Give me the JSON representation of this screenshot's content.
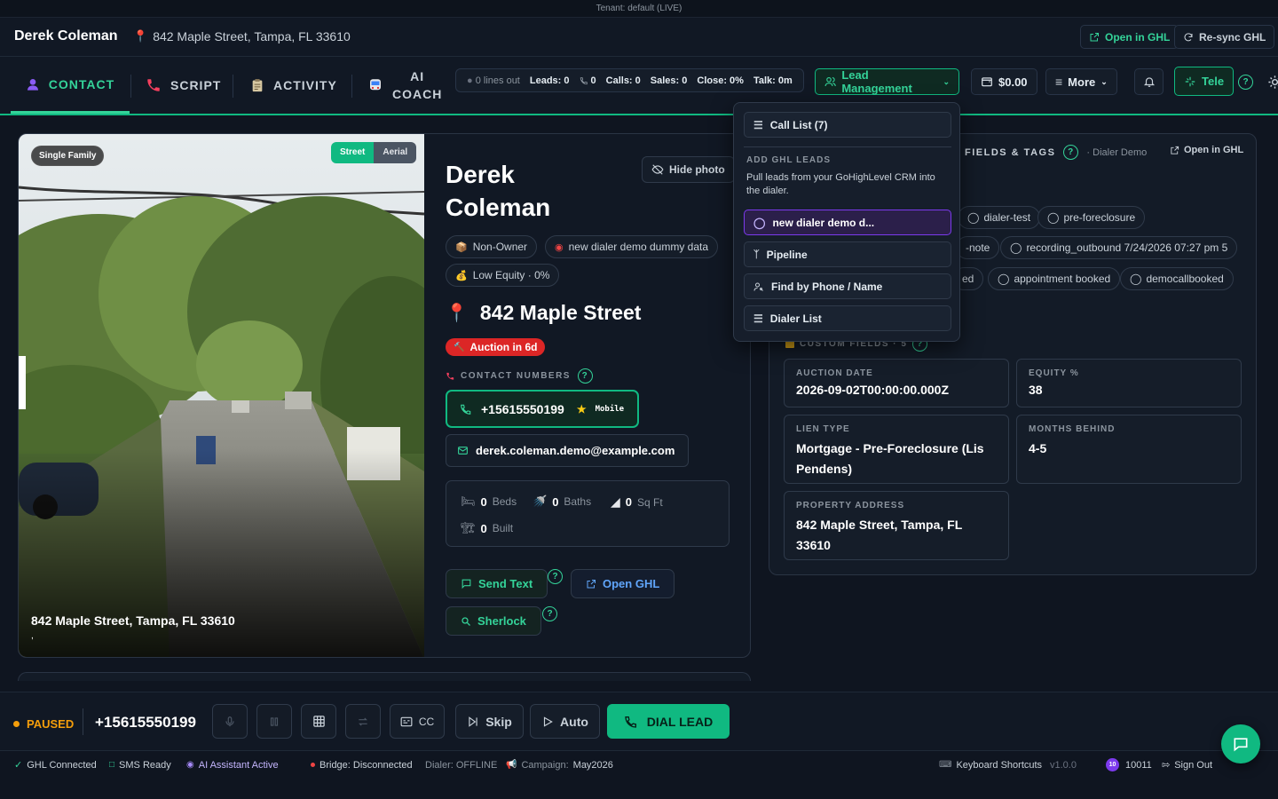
{
  "tenant": "Tenant: default (LIVE)",
  "header": {
    "contact_name": "Derek Coleman",
    "address": "842 Maple Street, Tampa, FL 33610",
    "open_ghl": "Open in GHL",
    "resync_ghl": "Re-sync GHL"
  },
  "tabs": [
    {
      "label": "CONTACT"
    },
    {
      "label": "SCRIPT"
    },
    {
      "label": "ACTIVITY"
    },
    {
      "label_line1": "AI",
      "label_line2": "COACH"
    }
  ],
  "stats": {
    "lines_out": "0 lines out",
    "leads": "Leads: 0",
    "phone_count": "0",
    "calls": "Calls: 0",
    "sales": "Sales: 0",
    "close": "Close: 0%",
    "talk": "Talk: 0m"
  },
  "nav": {
    "lead_management": "Lead Management",
    "balance": "$0.00",
    "more": "More",
    "tele": "Tele"
  },
  "dropdown": {
    "call_list": "Call List (7)",
    "section_title": "ADD GHL LEADS",
    "section_desc": "Pull leads from your GoHighLevel CRM into the dialer.",
    "items": [
      "new dialer demo d...",
      "Pipeline",
      "Find by Phone / Name",
      "Dialer List"
    ]
  },
  "photo": {
    "tag": "Single Family",
    "street_btn": "Street",
    "aerial_btn": "Aerial",
    "caption": "842 Maple Street, Tampa, FL 33610",
    "caption_sub": ","
  },
  "contact": {
    "first_name": "Derek",
    "last_name": "Coleman",
    "hide_photo": "Hide photo",
    "chips": [
      "Non-Owner",
      "new dialer demo dummy data",
      "Low Equity · 0%"
    ],
    "street": "842 Maple Street",
    "auction": "Auction in 6d",
    "numbers_label": "CONTACT NUMBERS",
    "phone": "+15615550199",
    "phone_type": "Mobile",
    "email": "derek.coleman.demo@example.com",
    "beds_val": "0",
    "beds_lbl": "Beds",
    "baths_val": "0",
    "baths_lbl": "Baths",
    "sqft_val": "0",
    "sqft_lbl": "Sq Ft",
    "built_val": "0",
    "built_lbl": "Built",
    "send_text": "Send Text",
    "open_ghl": "Open GHL",
    "sherlock": "Sherlock"
  },
  "right_panel": {
    "title": "FIELDS & TAGS",
    "subtitle": "· Dialer Demo",
    "open_ghl": "Open in GHL",
    "tags": [
      "dialer-test",
      "pre-foreclosure",
      "-note",
      "recording_outbound 7/24/2026 07:27 pm 5",
      "ed",
      "appointment booked",
      "democallbooked"
    ],
    "custom_fields_label": "CUSTOM FIELDS · 5",
    "fields": [
      {
        "label": "AUCTION DATE",
        "value": "2026-09-02T00:00:00.000Z"
      },
      {
        "label": "EQUITY %",
        "value": "38"
      },
      {
        "label": "LIEN TYPE",
        "value": "Mortgage - Pre-Foreclosure (Lis Pendens)"
      },
      {
        "label": "MONTHS BEHIND",
        "value": "4-5"
      },
      {
        "label": "PROPERTY ADDRESS",
        "value": "842 Maple Street, Tampa, FL 33610"
      }
    ]
  },
  "callbar": {
    "status": "PAUSED",
    "number": "+15615550199",
    "cc": "CC",
    "skip": "Skip",
    "auto": "Auto",
    "dial": "DIAL LEAD"
  },
  "statusbar": {
    "ghl": "GHL Connected",
    "sms": "SMS Ready",
    "ai": "AI Assistant Active",
    "bridge": "Bridge: Disconnected",
    "dialer": "Dialer: OFFLINE",
    "campaign_lbl": "Campaign:",
    "campaign": "May2026",
    "shortcuts": "Keyboard Shortcuts",
    "version": "v1.0.0",
    "user_badge": "10",
    "user_id": "10011",
    "sign_out": "Sign Out"
  },
  "colors": {
    "accent": "#10b981",
    "danger": "#dc2626",
    "purple": "#7c3aed",
    "bg": "#0f1520"
  }
}
